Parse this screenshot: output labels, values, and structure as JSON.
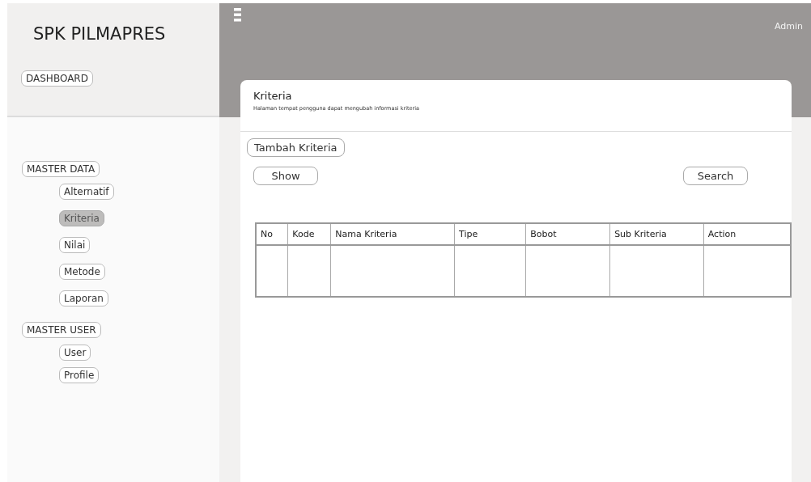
{
  "sidebar": {
    "title": "SPK PILMAPRES",
    "dashboard": "DASHBOARD",
    "groups": [
      {
        "label": "MASTER DATA",
        "items": [
          {
            "label": "Alternatif",
            "selected": false
          },
          {
            "label": "Kriteria",
            "selected": true
          },
          {
            "label": "Nilai",
            "selected": false
          },
          {
            "label": "Metode",
            "selected": false
          },
          {
            "label": "Laporan",
            "selected": false
          }
        ]
      },
      {
        "label": "MASTER USER",
        "items": [
          {
            "label": "User",
            "selected": false
          },
          {
            "label": "Profile",
            "selected": false
          }
        ]
      }
    ]
  },
  "header": {
    "user": "Admin"
  },
  "card": {
    "title": "Kriteria",
    "subtitle": "Halaman tempat pengguna dapat mengubah informasi kriteria",
    "add_button": "Tambah Kriteria",
    "show_button": "Show",
    "search_button": "Search",
    "table": {
      "columns": [
        "No",
        "Kode",
        "Nama Kriteria",
        "Tipe",
        "Bobot",
        "Sub Kriteria",
        "Action"
      ]
    }
  }
}
